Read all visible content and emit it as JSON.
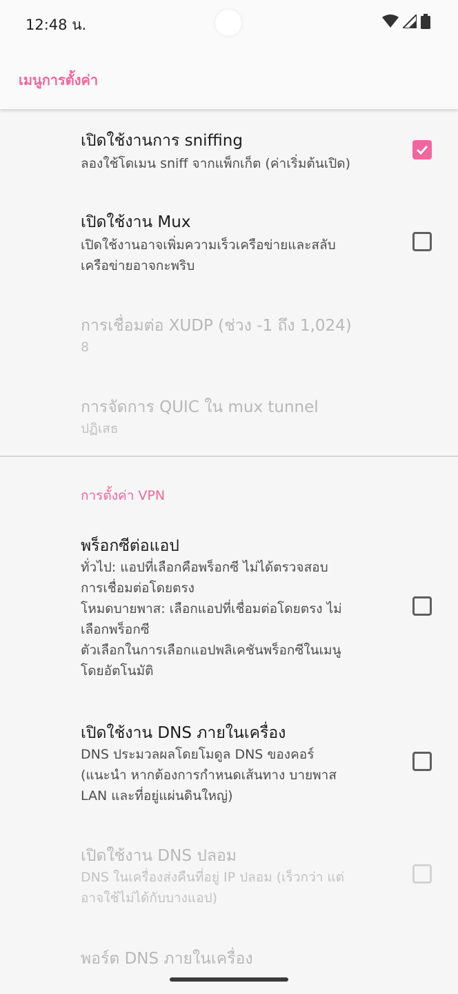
{
  "status_bar": {
    "time": "12:48 น.",
    "icons": [
      "wifi-icon",
      "cell-signal-icon",
      "battery-icon"
    ]
  },
  "app_bar": {
    "title": "เมนูการตั้งค่า"
  },
  "colors": {
    "accent": "#f0669d",
    "divider": "#d9d9d9",
    "background": "#f6f6f6"
  },
  "settings": {
    "sniffing": {
      "title": "เปิดใช้งานการ sniffing",
      "summary": "ลองใช้โดเมน sniff จากแพ็กเก็ต (ค่าเริ่มต้นเปิด)",
      "checked": true
    },
    "mux": {
      "title": "เปิดใช้งาน Mux",
      "summary_line1": "เปิดใช้งานอาจเพิ่มความเร็วเครือข่ายและสลับ",
      "summary_line2": "เครือข่ายอาจกะพริบ",
      "checked": false
    },
    "xudp": {
      "title": "การเชื่อมต่อ XUDP (ช่วง -1 ถึง 1,024)",
      "value": "8"
    },
    "quic": {
      "title": "การจัดการ QUIC ใน mux tunnel",
      "value": "ปฏิเสธ"
    }
  },
  "vpn_section": {
    "header": "การตั้งค่า VPN",
    "per_app_proxy": {
      "title": "พร็อกซีต่อแอป",
      "summary_lines": [
        "ทั่วไป: แอปที่เลือกคือพร็อกซี ไม่ได้ตรวจสอบ",
        "การเชื่อมต่อโดยตรง",
        "โหมดบายพาส: เลือกแอปที่เชื่อมต่อโดยตรง ไม่",
        "เลือกพร็อกซี",
        "ตัวเลือกในการเลือกแอปพลิเคชันพร็อกซีในเมนู",
        "โดยอัตโนมัติ"
      ],
      "checked": false
    },
    "local_dns": {
      "title": "เปิดใช้งาน DNS ภายในเครื่อง",
      "summary_lines": [
        "DNS ประมวลผลโดยโมดูล DNS ของคอร์",
        "(แนะนำ หากต้องการกำหนดเส้นทาง บายพาส",
        "LAN และที่อยู่แผ่นดินใหญ่)"
      ],
      "checked": false
    },
    "fake_dns": {
      "title": "เปิดใช้งาน DNS ปลอม",
      "summary_lines": [
        "DNS ในเครื่องส่งคืนที่อยู่ IP ปลอม (เร็วกว่า แต่",
        "อาจใช้ไม่ได้กับบางแอป)"
      ],
      "checked": false
    },
    "local_dns_port": {
      "title": "พอร์ต DNS ภายในเครื่อง"
    }
  }
}
